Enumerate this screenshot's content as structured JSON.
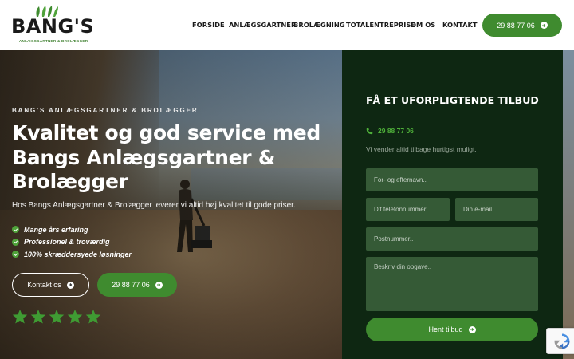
{
  "logo": {
    "wordmark": "BANG'S",
    "tagline": "ANLÆGSGARTNER  &  BROLÆGGER"
  },
  "nav": {
    "items": [
      "FORSIDE",
      "ANLÆGSGARTNER",
      "BROLÆGNING",
      "TOTALENTREPRISE",
      "OM OS",
      "KONTAKT"
    ],
    "phone_button": "29 88 77 06"
  },
  "hero": {
    "kicker": "BANG'S ANLÆGSGARTNER & BROLÆGGER",
    "headline": "Kvalitet og god service med Bangs Anlægsgartner & Brolægger",
    "subtext": "Hos Bangs Anlægsgartner & Brolægger leverer vi altid høj kvalitet til gode priser.",
    "checks": [
      "Mange års erfaring",
      "Professionel & troværdig",
      "100% skræddersyede løsninger"
    ],
    "contact_button": "Kontakt os",
    "phone_button": "29 88 77 06",
    "rating_stars": 5
  },
  "form": {
    "title": "FÅ ET UFORPLIGTENDE TILBUD",
    "phone": "29 88 77 06",
    "note": "Vi vender altid tilbage hurtigst muligt.",
    "name_placeholder": "For- og efternavn..",
    "phone_placeholder": "Dit telefonnummer..",
    "email_placeholder": "Din e-mail..",
    "zip_placeholder": "Postnummer..",
    "task_placeholder": "Beskriv din opgave..",
    "submit_label": "Hent tilbud"
  },
  "colors": {
    "brand_green": "#3f8b2f",
    "panel_dark": "#0e2712",
    "field_green": "#355a36",
    "star_green": "#3f9b33"
  },
  "icons": {
    "arrow": "arrow-right-circle-icon",
    "check": "check-circle-icon",
    "phone": "phone-icon",
    "star": "star-icon",
    "recaptcha": "recaptcha-icon"
  }
}
